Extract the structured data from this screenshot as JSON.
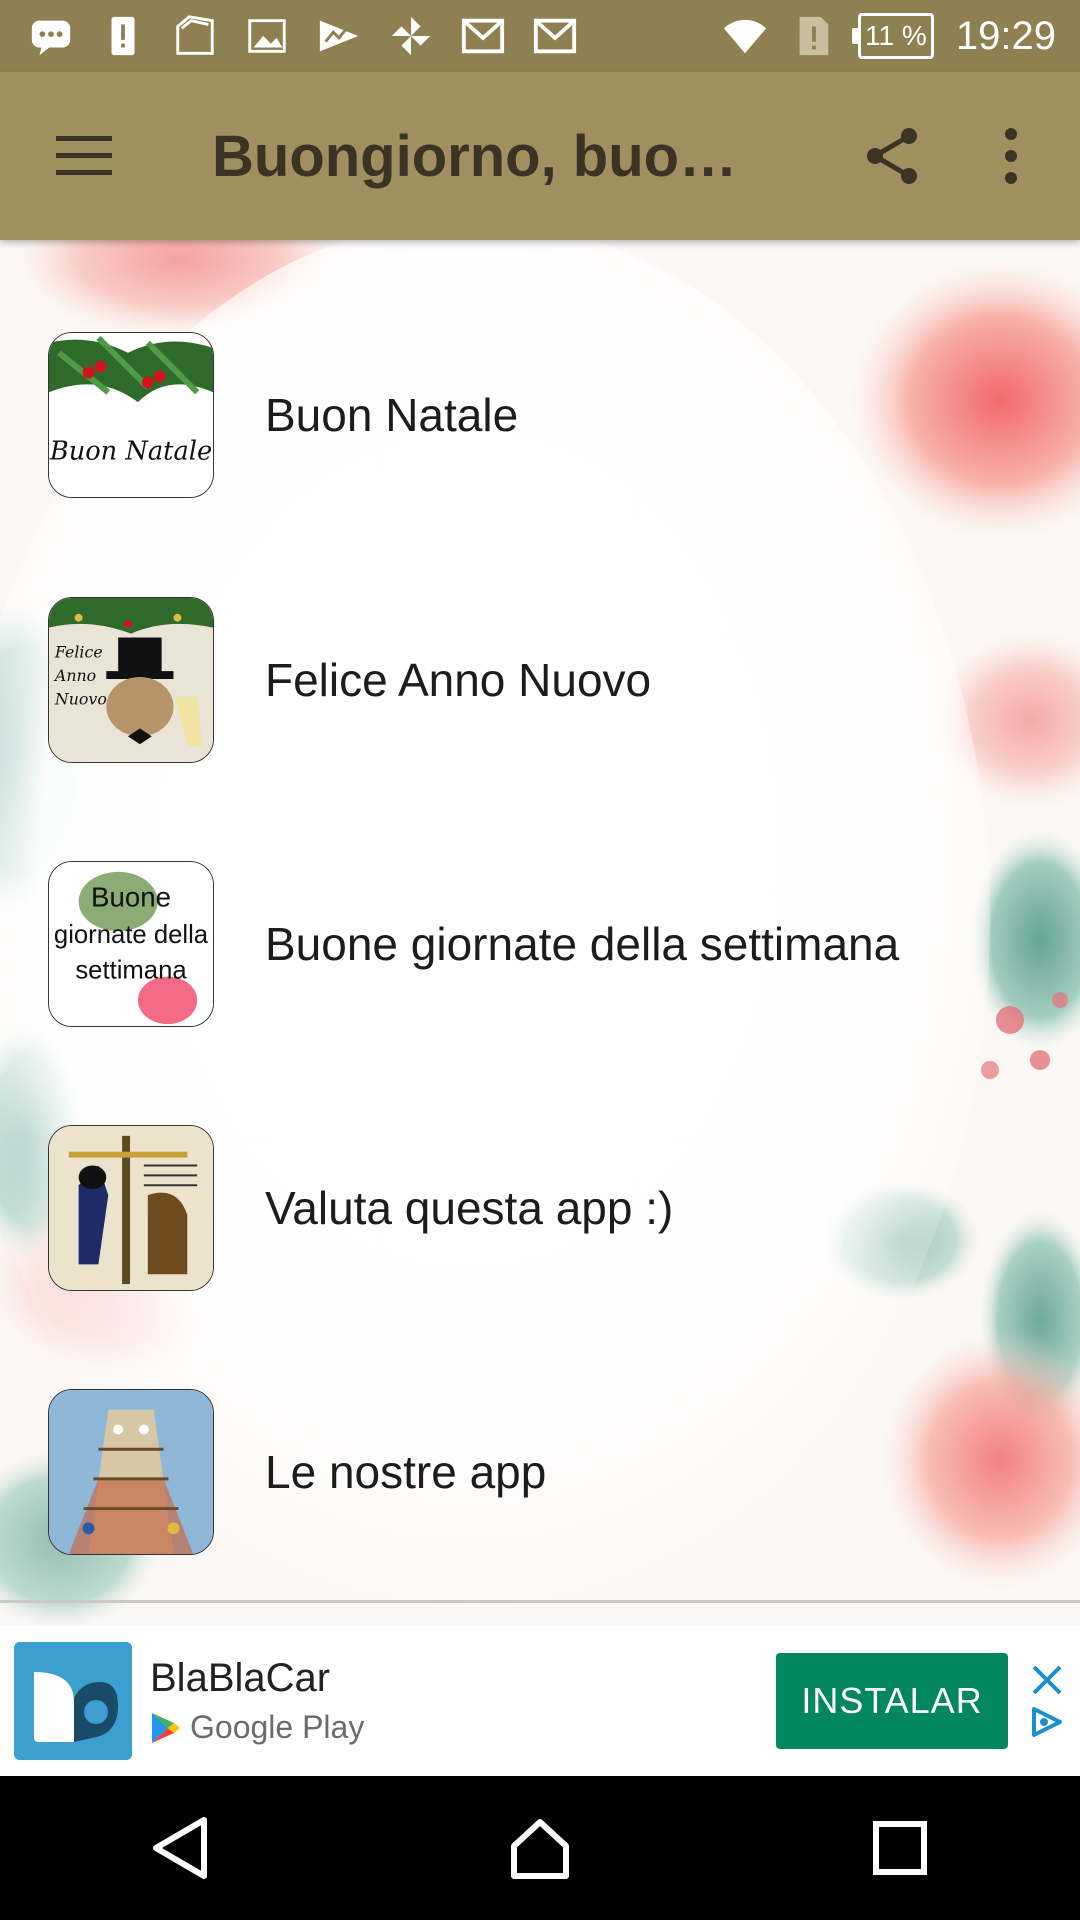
{
  "status_bar": {
    "battery": "11 %",
    "time": "19:29",
    "icons": [
      "message-icon",
      "alert-icon",
      "sim-icon",
      "image-icon",
      "activity-icon",
      "pinwheel-icon",
      "gmail-icon",
      "gmail-icon",
      "wifi-icon",
      "no-sim-icon",
      "battery-icon"
    ]
  },
  "app_bar": {
    "title": "Buongiorno, buona…",
    "menu_icon": "hamburger-menu-icon",
    "share_icon": "share-icon",
    "more_icon": "more-vert-icon",
    "color": "#a08f5f"
  },
  "list": {
    "items": [
      {
        "label": "Buon Natale",
        "thumb_text": "Buon Natale"
      },
      {
        "label": "Felice Anno Nuovo",
        "thumb_text": "Felice Anno Nuovo"
      },
      {
        "label": "Buone giornate della settimana",
        "thumb_text": "Buone giornate della settimana"
      },
      {
        "label": "Valuta questa app :)",
        "thumb_text": ""
      },
      {
        "label": "Le nostre app",
        "thumb_text": ""
      }
    ]
  },
  "ad": {
    "app_name": "BlaBlaCar",
    "store": "Google Play",
    "install_label": "INSTALAR",
    "install_color": "#01875f"
  },
  "nav_bar": {
    "icons": [
      "back-icon",
      "home-icon",
      "recents-icon"
    ]
  }
}
